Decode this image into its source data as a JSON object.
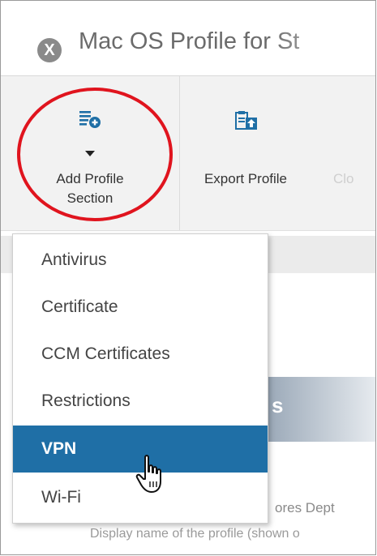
{
  "window": {
    "title": "Mac OS Profile for St",
    "icon": "x-circle-icon"
  },
  "toolbar": {
    "add_profile_section": {
      "label_line1": "Add Profile",
      "label_line2": "Section",
      "icon": "add-list-icon",
      "dropdown_icon": "caret-down-icon"
    },
    "export_profile": {
      "label": "Export Profile",
      "icon": "export-profile-icon"
    },
    "clone": {
      "label": "Clo"
    }
  },
  "menu": {
    "items": [
      {
        "label": "Antivirus"
      },
      {
        "label": "Certificate"
      },
      {
        "label": "CCM Certificates"
      },
      {
        "label": "Restrictions"
      },
      {
        "label": "VPN"
      },
      {
        "label": "Wi-Fi"
      }
    ],
    "selected": "VPN"
  },
  "background": {
    "section_heading": "s",
    "name_value": "ores Dept",
    "name_hint": "Display name of the profile (shown o"
  },
  "colors": {
    "selected_bg": "#1f6fa6",
    "annotation": "#e0141e",
    "toolbar_bg": "#f2f2f2"
  }
}
